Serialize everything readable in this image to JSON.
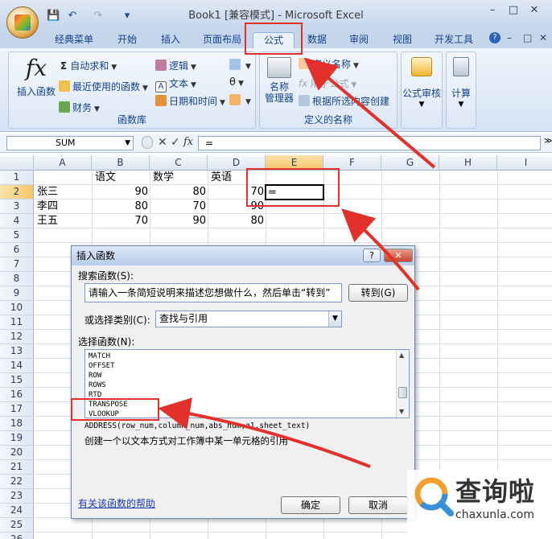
{
  "window": {
    "title": "Book1  [兼容模式] - Microsoft Excel",
    "controls": [
      "–",
      "□",
      "✕"
    ]
  },
  "qat": {
    "save": "💾",
    "undo": "↶",
    "redo": "↷",
    "more": "▾"
  },
  "tabs": [
    {
      "label": "经典菜单"
    },
    {
      "label": "开始"
    },
    {
      "label": "插入"
    },
    {
      "label": "页面布局"
    },
    {
      "label": "公式",
      "active": true
    },
    {
      "label": "数据"
    },
    {
      "label": "审阅"
    },
    {
      "label": "视图"
    },
    {
      "label": "开发工具"
    }
  ],
  "tab_right": {
    "help": "?",
    "min": "–",
    "restore": "□",
    "close": "✕"
  },
  "ribbon": {
    "function_library": {
      "label": "函数库",
      "insert_function": "插入函数",
      "autosum": "自动求和",
      "recent": "最近使用的函数",
      "financial": "财务",
      "logical": "逻辑",
      "text": "文本",
      "datetime": "日期和时间"
    },
    "defined_names": {
      "label": "定义的名称",
      "name_manager_l1": "名称",
      "name_manager_l2": "管理器",
      "define_name": "定义名称",
      "use_in_formula": "用于公式",
      "create_from_selection": "根据所选内容创建"
    },
    "formula_auditing": {
      "label": "公式审核"
    },
    "calculation": {
      "label": "计算"
    }
  },
  "formula_bar": {
    "name_box": "SUM",
    "formula": "="
  },
  "columns": [
    "A",
    "B",
    "C",
    "D",
    "E",
    "F",
    "G",
    "H",
    "I"
  ],
  "rows": [
    "1",
    "2",
    "3",
    "4",
    "5",
    "6",
    "7",
    "8",
    "9",
    "10",
    "11",
    "12",
    "13",
    "14",
    "15",
    "16",
    "17",
    "18",
    "19",
    "20",
    "21",
    "22",
    "23",
    "24",
    "25",
    "26"
  ],
  "cells": {
    "b1": "语文",
    "c1": "数学",
    "d1": "英语",
    "a2": "张三",
    "b2": "90",
    "c2": "80",
    "d2": "70",
    "e2": "=",
    "a3": "李四",
    "b3": "80",
    "c3": "70",
    "d3": "90",
    "a4": "王五",
    "b4": "70",
    "c4": "90",
    "d4": "80"
  },
  "dialog": {
    "title": "插入函数",
    "help_btn": "?",
    "close_btn": "✕",
    "search_label": "搜索函数(S):",
    "search_text": "请输入一条简短说明来描述您想做什么，然后单击“转到”",
    "go_button": "转到(G)",
    "category_label": "或选择类别(C):",
    "category_value": "查找与引用",
    "list_label": "选择函数(N):",
    "functions": [
      "MATCH",
      "OFFSET",
      "ROW",
      "ROWS",
      "RTD",
      "TRANSPOSE",
      "VLOOKUP"
    ],
    "syntax": "ADDRESS(row_num,column_num,abs_num,a1,sheet_text)",
    "description": "创建一个以文本方式对工作簿中某一单元格的引用",
    "help_link": "有关该函数的帮助",
    "ok": "确定",
    "cancel": "取消"
  },
  "watermark": {
    "name": "查询啦",
    "url": "chaxunla.com"
  },
  "colors": {
    "annotation": "#e3302a",
    "tab_text": "#15428b",
    "link": "#1a38b5"
  }
}
